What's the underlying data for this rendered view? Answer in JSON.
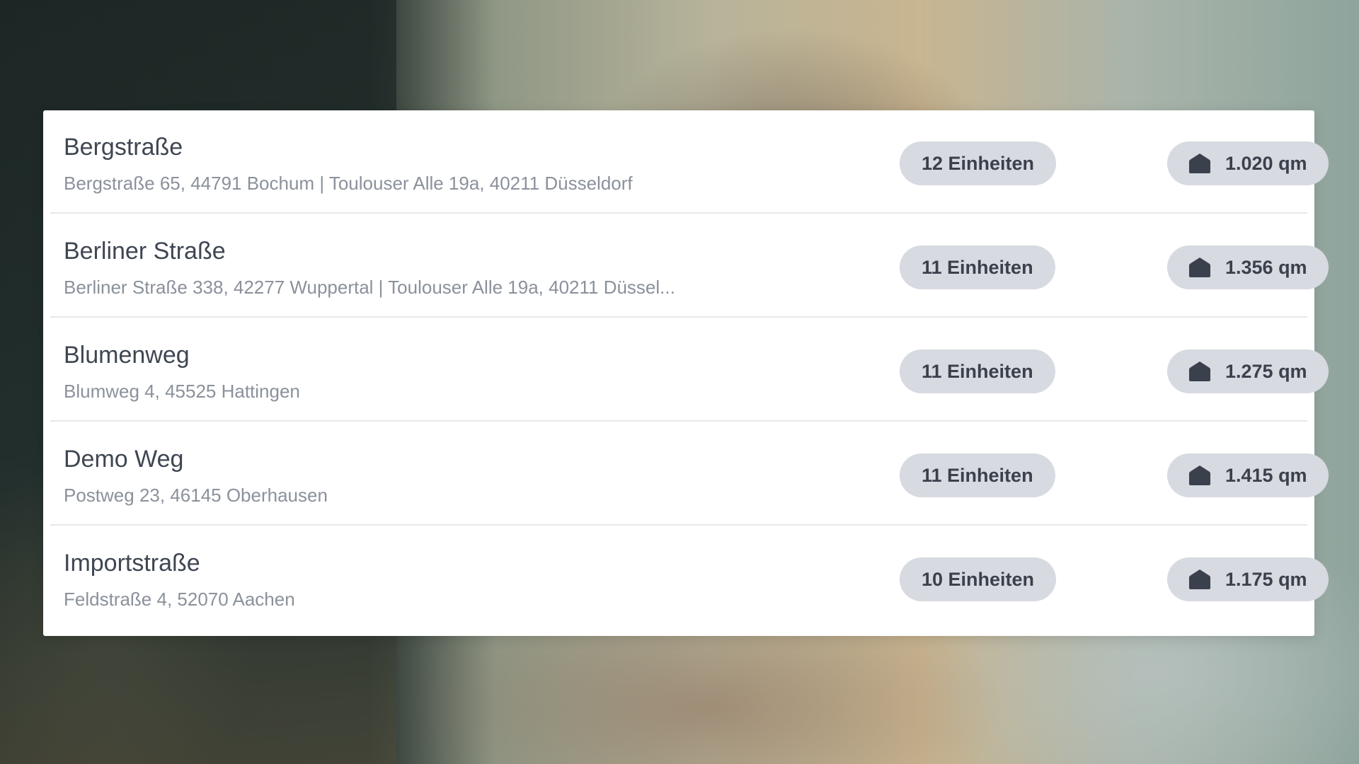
{
  "colors": {
    "pill_background": "#d7dae0",
    "title_text": "#3f4652",
    "address_text": "#8a919b",
    "divider": "#e5e7eb"
  },
  "properties": [
    {
      "name": "Bergstraße",
      "address": "Bergstraße 65, 44791 Bochum | Toulouser Alle 19a, 40211 Düsseldorf",
      "units": "12 Einheiten",
      "area_icon": "home-icon",
      "area": "1.020 qm"
    },
    {
      "name": "Berliner Straße",
      "address": "Berliner Straße 338, 42277 Wuppertal | Toulouser Alle 19a, 40211 Düssel...",
      "units": "11 Einheiten",
      "area_icon": "home-icon",
      "area": "1.356 qm"
    },
    {
      "name": "Blumenweg",
      "address": "Blumweg 4, 45525 Hattingen",
      "units": "11 Einheiten",
      "area_icon": "home-icon",
      "area": "1.275 qm"
    },
    {
      "name": "Demo Weg",
      "address": "Postweg 23, 46145 Oberhausen",
      "units": "11 Einheiten",
      "area_icon": "home-icon",
      "area": "1.415 qm"
    },
    {
      "name": "Importstraße",
      "address": "Feldstraße 4, 52070 Aachen",
      "units": "10 Einheiten",
      "area_icon": "home-icon",
      "area": "1.175 qm"
    }
  ]
}
